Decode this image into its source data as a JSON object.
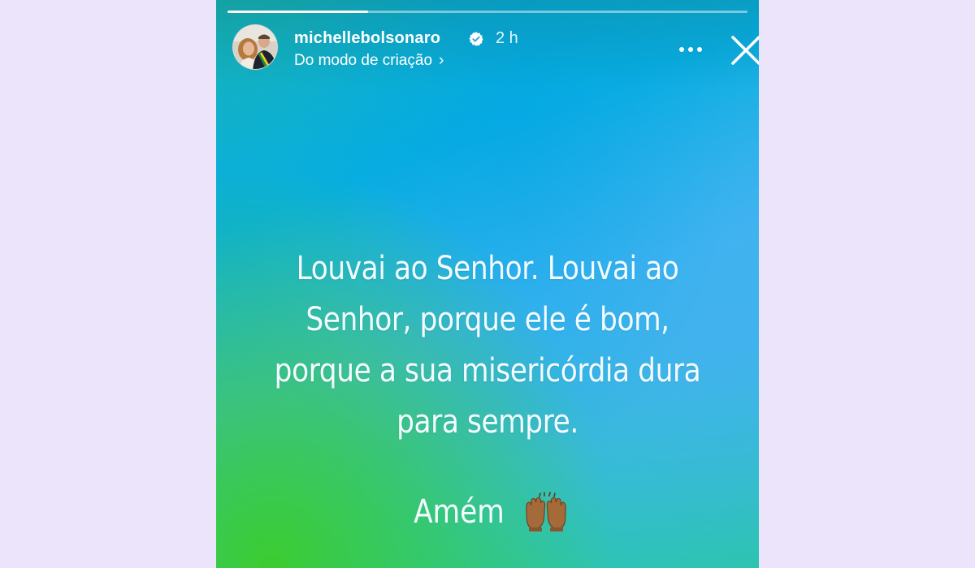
{
  "story": {
    "progress_fraction": 0.27,
    "username": "michellebolsonaro",
    "verified": true,
    "time": "2 h",
    "subtitle": "Do modo de criação",
    "subtitle_chevron": "›",
    "message_lines": [
      "Louvai ao Senhor. Louvai ao",
      "Senhor, porque ele é bom,",
      "porque a sua misericórdia dura",
      "para sempre."
    ],
    "closing": "Amém",
    "closing_emoji": "raising-hands-icon"
  },
  "colors": {
    "page_background": "#ebe4fa",
    "text": "#ffffff",
    "verified_badge": "#ffffff"
  },
  "icons": {
    "more": "more-horizontal-icon",
    "close": "close-icon",
    "verified": "verified-badge-icon"
  }
}
